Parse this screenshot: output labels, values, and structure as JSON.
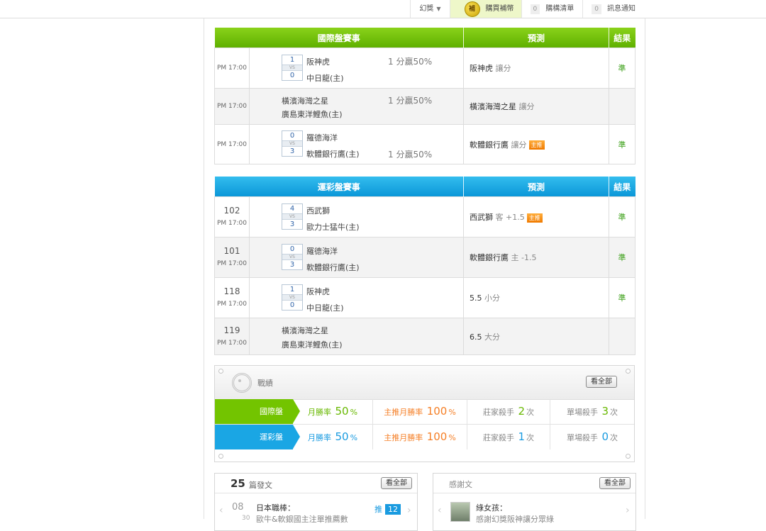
{
  "topnav": {
    "items": [
      {
        "label": "幻獎"
      },
      {
        "label": "購買補幣",
        "coin": "補"
      },
      {
        "label": "購構清單",
        "count": "0"
      },
      {
        "label": "訊息通知",
        "count": "0"
      }
    ]
  },
  "intl": {
    "headers": [
      "國際盤賽事",
      "預測",
      "結果"
    ],
    "rows": [
      {
        "time": "PM 17:00",
        "score1": "1",
        "vs": "VS",
        "score2": "0",
        "team1": "阪神虎",
        "team2": "中日龍(主)",
        "odds": "1 分贏50%",
        "pred_team": "阪神虎",
        "pred_detail": "讓分",
        "tag": "",
        "result": "準"
      },
      {
        "time": "PM 17:00",
        "team1": "橫濱海灣之星",
        "team2": "廣島東洋鯉魚(主)",
        "odds": "1 分贏50%",
        "pred_team": "橫濱海灣之星",
        "pred_detail": "讓分",
        "tag": "",
        "result": ""
      },
      {
        "time": "PM 17:00",
        "score1": "0",
        "vs": "VS",
        "score2": "3",
        "team1": "羅德海洋",
        "team2": "軟體銀行鷹(主)",
        "odds": "1 分贏50%",
        "pred_team": "軟體銀行鷹",
        "pred_detail": "讓分",
        "tag": "主推",
        "result": "準"
      }
    ]
  },
  "lottery": {
    "headers": [
      "運彩盤賽事",
      "預測",
      "結果"
    ],
    "rows": [
      {
        "no": "102",
        "time": "PM 17:00",
        "score1": "4",
        "vs": "VS",
        "score2": "3",
        "team1": "西武獅",
        "team2": "歐力士猛牛(主)",
        "pred_team": "西武獅",
        "pred_detail": "客 +1.5",
        "tag": "主推",
        "result": "準"
      },
      {
        "no": "101",
        "time": "PM 17:00",
        "score1": "0",
        "vs": "VS",
        "score2": "3",
        "team1": "羅德海洋",
        "team2": "軟體銀行鷹(主)",
        "pred_team": "軟體銀行鷹",
        "pred_detail": "主 -1.5",
        "tag": "",
        "result": "準"
      },
      {
        "no": "118",
        "time": "PM 17:00",
        "score1": "1",
        "vs": "VS",
        "score2": "0",
        "team1": "阪神虎",
        "team2": "中日龍(主)",
        "pred_team": "5.5",
        "pred_detail": "小分",
        "tag": "",
        "result": "準"
      },
      {
        "no": "119",
        "time": "PM 17:00",
        "team1": "橫濱海灣之星",
        "team2": "廣島東洋鯉魚(主)",
        "pred_team": "6.5",
        "pred_detail": "大分",
        "tag": "",
        "result": ""
      }
    ]
  },
  "record": {
    "title": "戰績",
    "view_all": "看全部",
    "rows": [
      {
        "label": "國際盤",
        "win_label": "月勝率",
        "win": "50",
        "main_label": "主推月勝率",
        "main": "100",
        "killer_label": "莊家殺手",
        "killer": "2",
        "single_label": "單場殺手",
        "single": "3",
        "unit": "次",
        "pct": "%"
      },
      {
        "label": "運彩盤",
        "win_label": "月勝率",
        "win": "50",
        "main_label": "主推月勝率",
        "main": "100",
        "killer_label": "莊家殺手",
        "killer": "1",
        "single_label": "單場殺手",
        "single": "0",
        "unit": "次",
        "pct": "%"
      }
    ]
  },
  "posts": {
    "count": "25",
    "label": "篇發文",
    "view_all": "看全部",
    "item": {
      "month": "08",
      "day": "30",
      "title": "日本職棒：",
      "sub": "歐牛&軟銀國主注單推薦數",
      "push_label": "推",
      "push": "12"
    }
  },
  "thanks": {
    "title": "感謝文",
    "view_all": "看全部",
    "item": {
      "name": "綠女孩：",
      "sub": "感謝幻獎阪神讓分眾綠"
    }
  },
  "colors": {
    "green": "#73c400",
    "blue": "#1aa6e4",
    "orange": "#f57f26",
    "result_green": "#3a9f16"
  }
}
